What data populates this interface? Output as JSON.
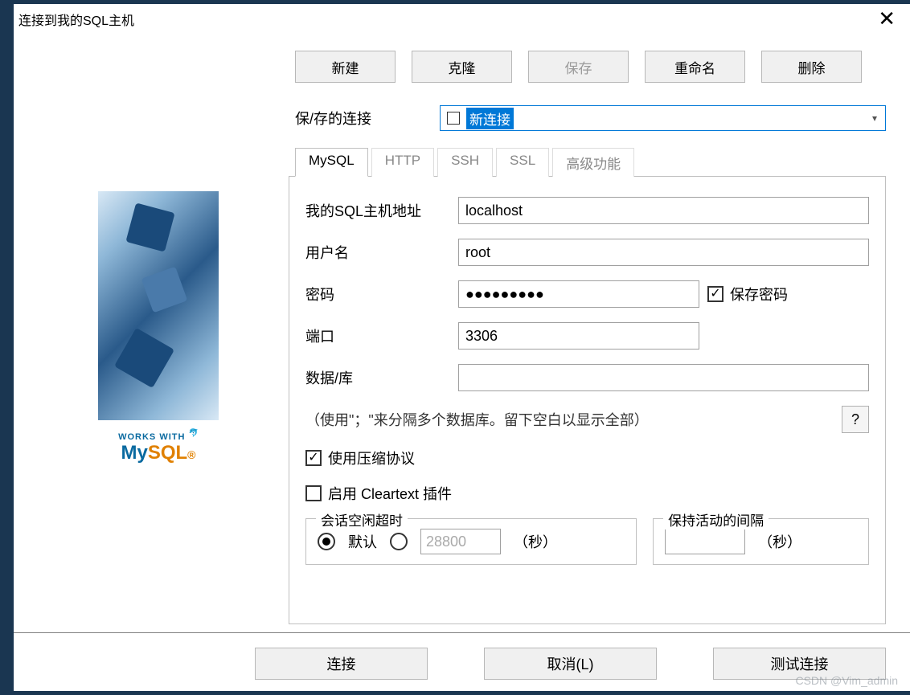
{
  "titlebar": {
    "title": "连接到我的SQL主机"
  },
  "topButtons": {
    "new": "新建",
    "clone": "克隆",
    "save": "保存",
    "rename": "重命名",
    "delete": "删除"
  },
  "savedConnections": {
    "label": "保/存的连接",
    "selected": "新连接"
  },
  "tabs": {
    "mysql": "MySQL",
    "http": "HTTP",
    "ssh": "SSH",
    "ssl": "SSL",
    "advanced": "高级功能"
  },
  "form": {
    "hostLabel": "我的SQL主机地址",
    "hostValue": "localhost",
    "userLabel": "用户名",
    "userValue": "root",
    "passLabel": "密码",
    "passValue": "●●●●●●●●●",
    "savePassLabel": "保存密码",
    "portLabel": "端口",
    "portValue": "3306",
    "dbLabel": "数据/库",
    "dbValue": "",
    "dbHint": "（使用\"；\"来分隔多个数据库。留下空白以显示全部）",
    "helpBtn": "?",
    "compressLabel": "使用压缩协议",
    "cleartextLabel": "启用 Cleartext 插件"
  },
  "timeout": {
    "sessionLegend": "会话空闲超时",
    "defaultLabel": "默认",
    "customValue": "28800",
    "unitSec": "（秒）",
    "keepaliveLegend": "保持活动的间隔",
    "keepaliveValue": ""
  },
  "footer": {
    "connect": "连接",
    "cancel": "取消(L)",
    "test": "测试连接"
  },
  "brand": {
    "worksWith": "WORKS WITH",
    "my": "My",
    "sql": "SQL"
  },
  "watermark": "CSDN @Vim_admin"
}
